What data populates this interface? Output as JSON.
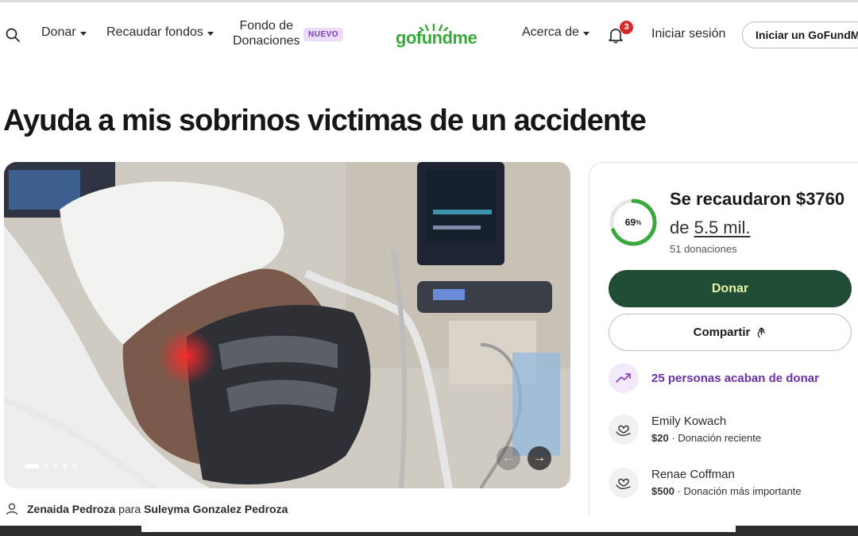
{
  "header": {
    "nav_donate": "Donar",
    "nav_fundraise": "Recaudar fondos",
    "nav_fund_line1": "Fondo de",
    "nav_fund_line2": "Donaciones",
    "badge_new": "NUEVO",
    "logo": "gofundme",
    "nav_about": "Acerca de",
    "notifications_count": "3",
    "login": "Iniciar sesión",
    "start_button": "Iniciar un GoFundMe",
    "brand_color": "#3aa83b"
  },
  "campaign": {
    "title": "Ayuda a mis sobrinos victimas de un accidente",
    "organizer": "Zenaida Pedroza",
    "organizer_connector": "para",
    "beneficiary": "Suleyma Gonzalez Pedroza",
    "photo_slides": 5,
    "photo_active_slide": 1
  },
  "progress": {
    "percent_label": "69",
    "percent_sign": "%",
    "percent_value": 0.69,
    "raised_text": "Se recaudaron $3760",
    "goal_prefix": "de",
    "goal_amount": "5.5 mil.",
    "donations_count": "51 donaciones",
    "ring_color": "#3aa83b"
  },
  "actions": {
    "donate_label": "Donar",
    "share_label": "Compartir",
    "donate_bg": "#204c35"
  },
  "activity": {
    "recent_text": "25 personas acaban de donar",
    "icon": "trending-up-icon"
  },
  "donors": [
    {
      "name": "Emily Kowach",
      "amount": "$20",
      "separator": "·",
      "note": "Donación reciente",
      "icon": "heart-hand-icon"
    },
    {
      "name": "Renae Coffman",
      "amount": "$500",
      "separator": "·",
      "note": "Donación más importante",
      "icon": "heart-hand-icon"
    }
  ]
}
